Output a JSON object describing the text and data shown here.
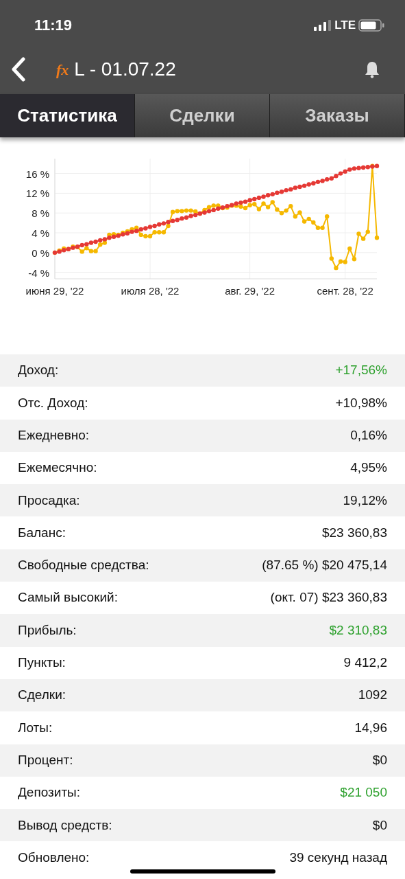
{
  "status_bar": {
    "time": "11:19",
    "network": "LTE"
  },
  "nav": {
    "logo": "fx",
    "title": "L - 01.07.22"
  },
  "tabs": [
    {
      "label": "Статистика",
      "selected": true
    },
    {
      "label": "Сделки",
      "selected": false
    },
    {
      "label": "Заказы",
      "selected": false
    }
  ],
  "chart_data": {
    "type": "line",
    "categories": [
      "июня 29, '22",
      null,
      null,
      null,
      null,
      null,
      null,
      null,
      null,
      null,
      null,
      null,
      null,
      null,
      null,
      null,
      null,
      null,
      null,
      null,
      null,
      "июля 28, '22",
      null,
      null,
      null,
      null,
      null,
      null,
      null,
      null,
      null,
      null,
      null,
      null,
      null,
      null,
      null,
      null,
      null,
      null,
      null,
      null,
      null,
      "авг. 29, '22",
      null,
      null,
      null,
      null,
      null,
      null,
      null,
      null,
      null,
      null,
      null,
      null,
      null,
      null,
      null,
      null,
      null,
      null,
      null,
      null,
      "сент. 28, '22",
      null,
      null,
      null,
      null,
      null,
      null,
      null
    ],
    "yticks": [
      {
        "value": -4,
        "label": "-4 %"
      },
      {
        "value": 0,
        "label": "0 %"
      },
      {
        "value": 4,
        "label": "4 %"
      },
      {
        "value": 8,
        "label": "8 %"
      },
      {
        "value": 12,
        "label": "12 %"
      },
      {
        "value": 16,
        "label": "16 %"
      }
    ],
    "ylim": [
      -5.3,
      19
    ],
    "grid": true,
    "series": [
      {
        "color": "#e53935",
        "marker": "circle",
        "values": [
          0,
          0.2,
          0.5,
          0.7,
          1.0,
          1.2,
          1.5,
          1.7,
          2.0,
          2.2,
          2.5,
          2.7,
          3.0,
          3.2,
          3.4,
          3.7,
          3.9,
          4.2,
          4.4,
          4.7,
          4.9,
          5.2,
          5.4,
          5.7,
          5.9,
          6.2,
          6.4,
          6.6,
          6.9,
          7.1,
          7.4,
          7.6,
          7.9,
          8.1,
          8.4,
          8.6,
          8.9,
          9.1,
          9.4,
          9.6,
          9.9,
          10.1,
          10.3,
          10.6,
          10.8,
          11.1,
          11.3,
          11.6,
          11.8,
          12.1,
          12.3,
          12.6,
          12.8,
          13.1,
          13.3,
          13.5,
          13.8,
          14.0,
          14.3,
          14.5,
          14.8,
          15.0,
          15.5,
          16.0,
          16.4,
          16.8,
          17.0,
          17.1,
          17.2,
          17.3,
          17.4,
          17.5
        ]
      },
      {
        "color": "#f5b800",
        "marker": "circle",
        "values": [
          0,
          0.4,
          0.8,
          0.7,
          1.2,
          1.1,
          0.2,
          0.9,
          0.3,
          0.3,
          1.6,
          2.0,
          3.6,
          3.7,
          3.6,
          4.0,
          4.3,
          4.7,
          5.0,
          3.6,
          3.3,
          3.3,
          4.1,
          4.1,
          4.1,
          5.4,
          8.2,
          8.4,
          8.4,
          8.5,
          8.5,
          8.3,
          7.9,
          8.6,
          9.2,
          9.5,
          9.5,
          9.0,
          9.1,
          9.5,
          9.5,
          9.3,
          9.0,
          9.6,
          9.8,
          8.8,
          9.9,
          9.2,
          10.2,
          8.7,
          8.0,
          8.5,
          9.4,
          7.3,
          8.1,
          6.3,
          6.8,
          6.1,
          5.0,
          5.0,
          7.3,
          -1.2,
          -3.1,
          -1.8,
          -1.9,
          0.8,
          -1.3,
          3.8,
          2.8,
          4.2,
          17.5,
          3.0
        ]
      }
    ]
  },
  "stats": [
    {
      "label": "Доход:",
      "value": "+17,56%",
      "color": "#2ea12e"
    },
    {
      "label": "Отс. Доход:",
      "value": "+10,98%",
      "color": "#111111"
    },
    {
      "label": "Ежедневно:",
      "value": "0,16%",
      "color": "#111111"
    },
    {
      "label": "Ежемесячно:",
      "value": "4,95%",
      "color": "#111111"
    },
    {
      "label": "Просадка:",
      "value": "19,12%",
      "color": "#111111"
    },
    {
      "label": "Баланс:",
      "value": "$23 360,83",
      "color": "#111111"
    },
    {
      "label": "Свободные средства:",
      "value": "(87.65 %) $20 475,14",
      "color": "#111111"
    },
    {
      "label": "Самый высокий:",
      "value": "(окт. 07) $23 360,83",
      "color": "#111111"
    },
    {
      "label": "Прибыль:",
      "value": "$2 310,83",
      "color": "#2ea12e"
    },
    {
      "label": "Пункты:",
      "value": "9 412,2",
      "color": "#111111"
    },
    {
      "label": "Сделки:",
      "value": "1092",
      "color": "#111111"
    },
    {
      "label": "Лоты:",
      "value": "14,96",
      "color": "#111111"
    },
    {
      "label": "Процент:",
      "value": "$0",
      "color": "#111111"
    },
    {
      "label": "Депозиты:",
      "value": "$21 050",
      "color": "#2ea12e"
    },
    {
      "label": "Вывод средств:",
      "value": "$0",
      "color": "#111111"
    },
    {
      "label": "Обновлено:",
      "value": "39 секунд назад",
      "color": "#111111"
    }
  ]
}
